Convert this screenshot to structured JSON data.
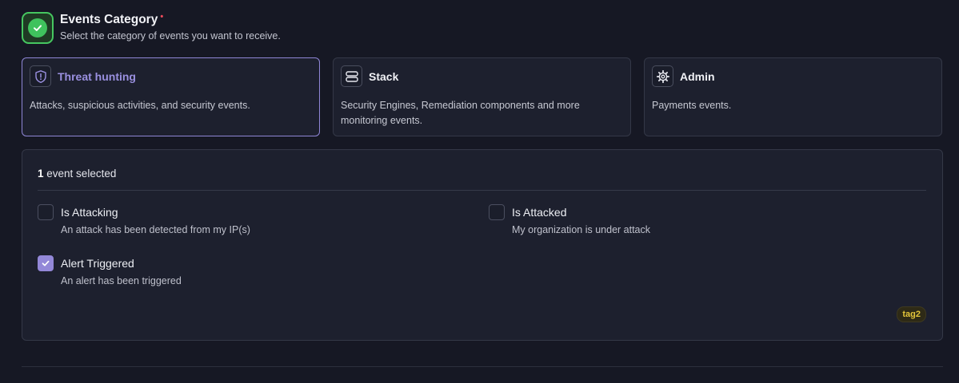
{
  "header": {
    "title": "Events Category",
    "required_marker": "•",
    "subtitle": "Select the category of events you want to receive.",
    "icon": "check-circle-icon"
  },
  "categories": [
    {
      "icon": "shield-alert-icon",
      "title": "Threat hunting",
      "description": "Attacks, suspicious activities, and security events.",
      "selected": true
    },
    {
      "icon": "server-stack-icon",
      "title": "Stack",
      "description": "Security Engines, Remediation components and more monitoring events.",
      "selected": false
    },
    {
      "icon": "gear-icon",
      "title": "Admin",
      "description": "Payments events.",
      "selected": false
    }
  ],
  "events_panel": {
    "selected_count": "1",
    "selected_suffix": "event selected",
    "events": [
      {
        "label": "Is Attacking",
        "description": "An attack has been detected from my IP(s)",
        "checked": false
      },
      {
        "label": "Is Attacked",
        "description": "My organization is under attack",
        "checked": false
      },
      {
        "label": "Alert Triggered",
        "description": "An alert has been triggered",
        "checked": true
      }
    ],
    "tag": "tag2"
  },
  "colors": {
    "accent": "#9388d8",
    "success": "#3fc25d",
    "required": "#ef4b5b",
    "tag_text": "#e3c53a"
  }
}
